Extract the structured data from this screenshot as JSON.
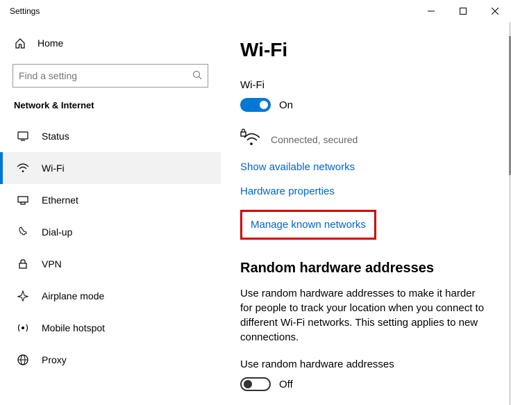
{
  "window": {
    "title": "Settings"
  },
  "sidebar": {
    "home": "Home",
    "search_placeholder": "Find a setting",
    "section": "Network & Internet",
    "items": [
      {
        "label": "Status"
      },
      {
        "label": "Wi-Fi"
      },
      {
        "label": "Ethernet"
      },
      {
        "label": "Dial-up"
      },
      {
        "label": "VPN"
      },
      {
        "label": "Airplane mode"
      },
      {
        "label": "Mobile hotspot"
      },
      {
        "label": "Proxy"
      }
    ]
  },
  "main": {
    "title": "Wi-Fi",
    "wifi_label": "Wi-Fi",
    "wifi_toggle": "On",
    "conn_status": "Connected, secured",
    "links": {
      "show_available": "Show available networks",
      "hardware_props": "Hardware properties",
      "manage_known": "Manage known networks"
    },
    "random": {
      "heading": "Random hardware addresses",
      "body": "Use random hardware addresses to make it harder for people to track your location when you connect to different Wi-Fi networks. This setting applies to new connections.",
      "toggle_label": "Use random hardware addresses",
      "toggle_state": "Off"
    }
  }
}
